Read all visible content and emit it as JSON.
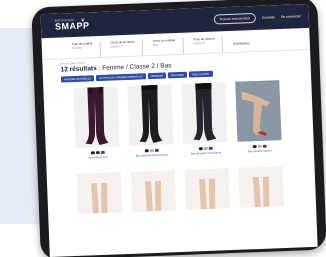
{
  "brand": {
    "small": "BIENVENUE",
    "name": "SMAPP"
  },
  "nav": {
    "primary": "Trouver mon produit",
    "links": [
      "Conseils",
      "Se connecter"
    ]
  },
  "filters": [
    {
      "label": "Type de produit",
      "value": "Femme"
    },
    {
      "label": "Choix de la classe",
      "value": "Classe 2"
    },
    {
      "label": "Choix du modèle",
      "value": "Bas"
    },
    {
      "label": "Prise de mesure",
      "value": "(V)(S)(T)"
    }
  ],
  "reset_label": "Réinitialiser",
  "breadcrumb": "Accueil / Bas Femme",
  "results": {
    "count": "12 résultats",
    "context": " : Femme / Classe 2 / Bas"
  },
  "tags": [
    "MATIÈRE NATURELLE",
    "ACTIFS AUX JAMBES/CORPS/FLUX",
    "PREMIUM",
    "FANTAISIE",
    "PIED OUVERT"
  ],
  "products": [
    {
      "name": "Bas Varisan Duo",
      "swatches": [
        "#1e1f2a",
        "#2b2d3a",
        "#43465a"
      ]
    },
    {
      "name": "Bas Varisan® Semi-Opaque",
      "swatches": [
        "#1e1f2a",
        "#c8a88e",
        "#43465a"
      ]
    },
    {
      "name": "Bas Varisan® Transparent",
      "swatches": [
        "#1e1f2a",
        "#c8a88e",
        "#43465a"
      ]
    },
    {
      "name": "Bas Varisan Fashion",
      "swatches": [
        "#1e1f2a",
        "#c8a88e",
        "#43465a"
      ]
    }
  ],
  "colors": {
    "topbar": "#20243e",
    "accent": "#2d4ba3",
    "tablet": "#1a1c20"
  }
}
